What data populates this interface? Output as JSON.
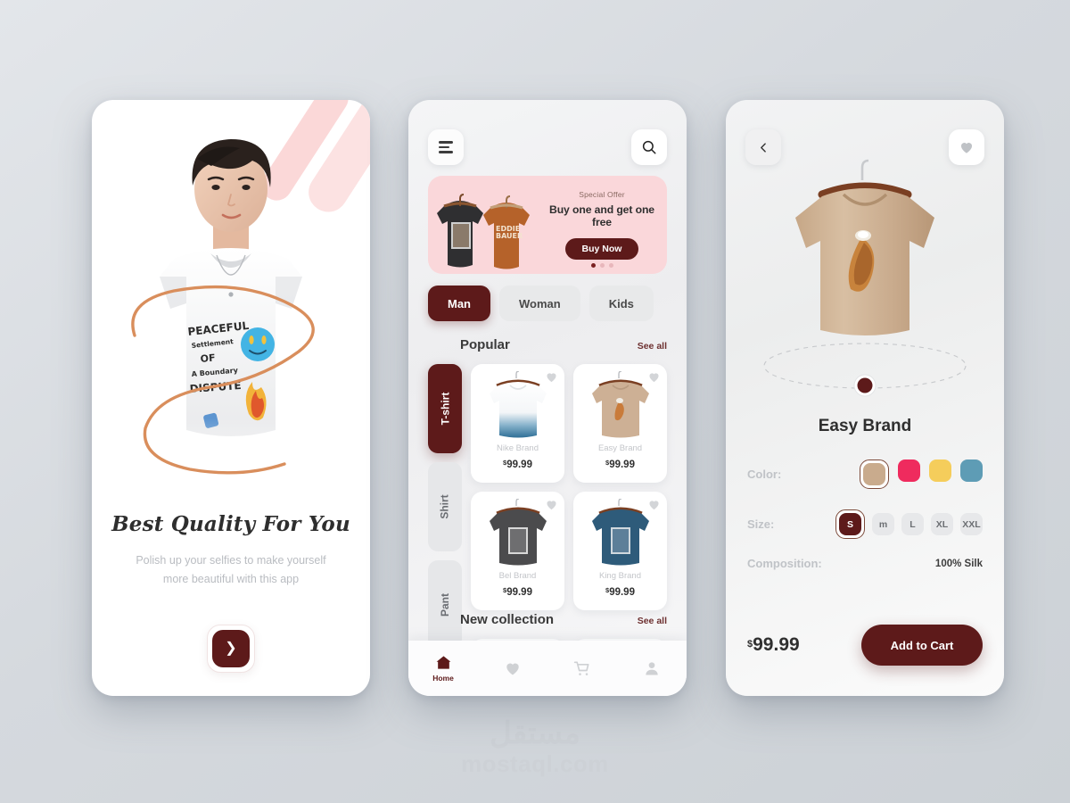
{
  "watermark": {
    "arabic": "مستقل",
    "latin": "mostaql.com"
  },
  "onboarding": {
    "title": "Best Quality For You",
    "subtitle": "Polish up your selfies to make yourself more beautiful with this app",
    "next_icon": "chevron-right-icon",
    "hero_alt": "young-man-graphic-tshirt"
  },
  "home": {
    "menu_icon": "hamburger-menu-icon",
    "search_icon": "search-icon",
    "banner": {
      "eyebrow": "Special Offer",
      "headline": "Buy one and get one free",
      "cta": "Buy Now",
      "slides": 3,
      "active_slide": 1
    },
    "categories": [
      {
        "label": "Man",
        "active": true
      },
      {
        "label": "Woman",
        "active": false
      },
      {
        "label": "Kids",
        "active": false
      }
    ],
    "side_tabs": [
      {
        "label": "T-shirt",
        "active": true
      },
      {
        "label": "Shirt",
        "active": false
      },
      {
        "label": "Pant",
        "active": false
      }
    ],
    "popular": {
      "title": "Popular",
      "see_all": "See all"
    },
    "new_collection": {
      "title": "New collection",
      "see_all": "See all"
    },
    "products": [
      {
        "name": "Nike Brand",
        "currency": "$",
        "price": "99.99",
        "shirt_color": "#ffffff",
        "accent": "#4d7fa0"
      },
      {
        "name": "Easy Brand",
        "currency": "$",
        "price": "99.99",
        "shirt_color": "#cdb095",
        "accent": "#b3692f"
      },
      {
        "name": "Bel Brand",
        "currency": "$",
        "price": "99.99",
        "shirt_color": "#4d4d4d",
        "accent": "#d8d8d8"
      },
      {
        "name": "King Brand",
        "currency": "$",
        "price": "99.99",
        "shirt_color": "#2e5b7a",
        "accent": "#cfd8de"
      }
    ],
    "bottom_nav": [
      {
        "icon": "home-icon",
        "label": "Home",
        "active": true
      },
      {
        "icon": "heart-icon",
        "label": "",
        "active": false
      },
      {
        "icon": "cart-icon",
        "label": "",
        "active": false
      },
      {
        "icon": "profile-icon",
        "label": "",
        "active": false
      }
    ]
  },
  "detail": {
    "back_icon": "chevron-left-icon",
    "favorite_icon": "heart-icon",
    "brand": "Easy Brand",
    "color_label": "Color:",
    "colors": [
      {
        "hex": "#c9ab8d",
        "selected": true
      },
      {
        "hex": "#ef2b5e",
        "selected": false
      },
      {
        "hex": "#f5cd5b",
        "selected": false
      },
      {
        "hex": "#5e9cb5",
        "selected": false
      }
    ],
    "size_label": "Size:",
    "sizes": [
      {
        "label": "S",
        "selected": true
      },
      {
        "label": "m",
        "selected": false
      },
      {
        "label": "L",
        "selected": false
      },
      {
        "label": "XL",
        "selected": false
      },
      {
        "label": "XXL",
        "selected": false
      }
    ],
    "composition_label": "Composition:",
    "composition_value": "100% Silk",
    "currency": "$",
    "price": "99.99",
    "add_to_cart": "Add to Cart"
  },
  "theme": {
    "accent": "#5d1a1a",
    "banner_bg": "#fad7da",
    "page_bg": "#d6d9dd"
  }
}
